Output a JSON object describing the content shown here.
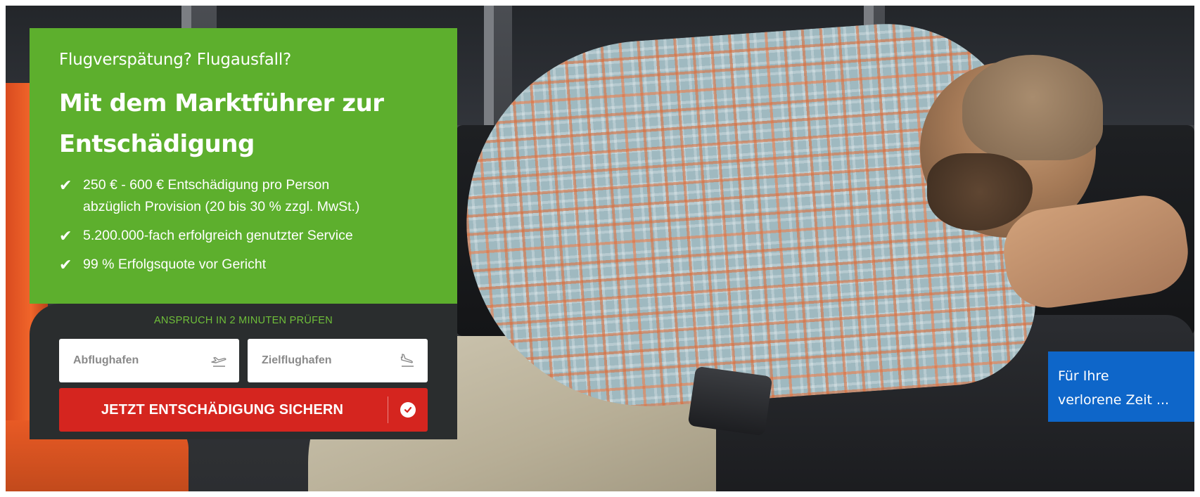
{
  "hero": {
    "kicker": "Flugverspätung? Flugausfall?",
    "headline_line1": "Mit dem Marktführer zur",
    "headline_line2": "Entschädigung",
    "benefits": [
      {
        "line1": "250 € - 600 € Entschädigung pro Person",
        "line2": "abzüglich Provision (20 bis 30 % zzgl. MwSt.)"
      },
      {
        "line1": "5.200.000-fach erfolgreich genutzter Service"
      },
      {
        "line1": "99 % Erfolgsquote vor Gericht"
      }
    ],
    "check_glyph": "✔"
  },
  "form": {
    "title": "ANSPRUCH IN 2 MINUTEN PRÜFEN",
    "departure_placeholder": "Abflughafen",
    "departure_icon": "plane-takeoff-icon",
    "arrival_placeholder": "Zielflughafen",
    "arrival_icon": "plane-landing-icon",
    "cta_label": "JETZT ENTSCHÄDIGUNG SICHERN"
  },
  "teaser": {
    "line1": "Für Ihre",
    "line2": "verlorene Zeit ..."
  },
  "colors": {
    "green": "#5daf2d",
    "dark": "#2a2d2e",
    "red": "#d5251f",
    "blue": "#0e66c9",
    "form_title": "#6fbf3a"
  }
}
